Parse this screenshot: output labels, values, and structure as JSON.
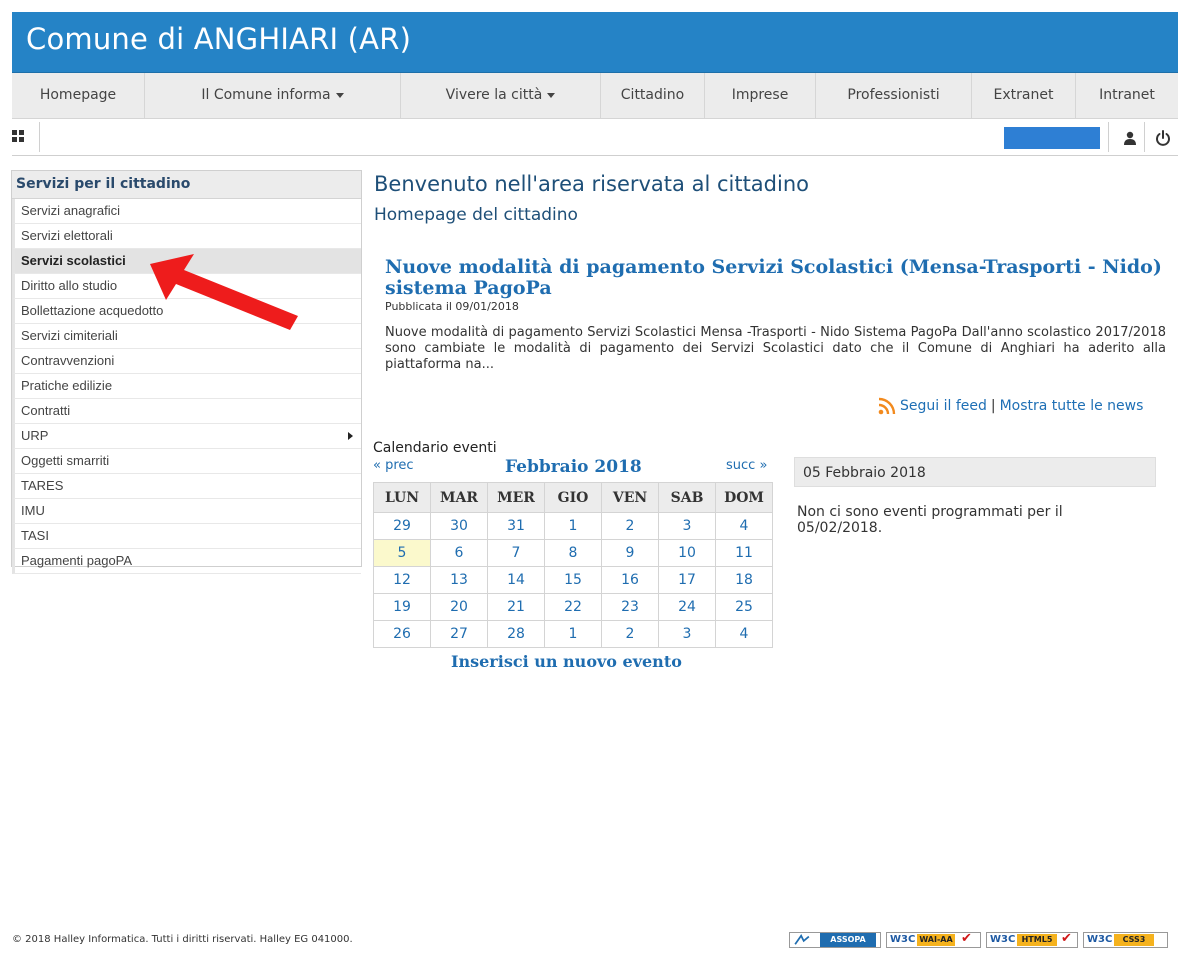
{
  "header": {
    "title": "Comune di ANGHIARI (AR)"
  },
  "nav": {
    "items": [
      {
        "label": "Homepage"
      },
      {
        "label": "Il Comune informa"
      },
      {
        "label": "Vivere la città"
      },
      {
        "label": "Cittadino"
      },
      {
        "label": "Imprese"
      },
      {
        "label": "Professionisti"
      },
      {
        "label": "Extranet"
      },
      {
        "label": "Intranet"
      }
    ]
  },
  "toolbar": {
    "icons": [
      "grid-icon",
      "user-icon",
      "power-icon"
    ],
    "accent": "#2e7fd4"
  },
  "sidebar": {
    "title": "Servizi per il cittadino",
    "items": [
      {
        "label": "Servizi anagrafici"
      },
      {
        "label": "Servizi elettorali"
      },
      {
        "label": "Servizi scolastici"
      },
      {
        "label": "Diritto allo studio"
      },
      {
        "label": "Bollettazione acquedotto"
      },
      {
        "label": "Servizi cimiteriali"
      },
      {
        "label": "Contravvenzioni"
      },
      {
        "label": "Pratiche edilizie"
      },
      {
        "label": "Contratti"
      },
      {
        "label": "URP"
      },
      {
        "label": "Oggetti smarriti"
      },
      {
        "label": "TARES"
      },
      {
        "label": "IMU"
      },
      {
        "label": "TASI"
      },
      {
        "label": "Pagamenti pagoPA"
      }
    ]
  },
  "main": {
    "title": "Benvenuto nell'area riservata al cittadino",
    "subtitle": "Homepage del cittadino",
    "news": {
      "title": "Nuove modalità di pagamento Servizi Scolastici (Mensa-Trasporti - Nido) sistema PagoPa",
      "date": "Pubblicata il 09/01/2018",
      "body": "Nuove modalità di pagamento Servizi Scolastici Mensa -Trasporti - Nido Sistema PagoPa  Dall'anno scolastico 2017/2018 sono cambiate le modalità di pagamento dei Servizi Scolastici dato che il Comune di Anghiari ha aderito alla piattaforma na..."
    },
    "feed": {
      "follow": "Segui il feed",
      "separator": "|",
      "all_news": "Mostra tutte le news"
    }
  },
  "calendar": {
    "label": "Calendario eventi",
    "prev": "« prec",
    "month": "Febbraio 2018",
    "next": "succ »",
    "days": [
      "LUN",
      "MAR",
      "MER",
      "GIO",
      "VEN",
      "SAB",
      "DOM"
    ],
    "weeks": [
      [
        "29",
        "30",
        "31",
        "1",
        "2",
        "3",
        "4"
      ],
      [
        "5",
        "6",
        "7",
        "8",
        "9",
        "10",
        "11"
      ],
      [
        "12",
        "13",
        "14",
        "15",
        "16",
        "17",
        "18"
      ],
      [
        "19",
        "20",
        "21",
        "22",
        "23",
        "24",
        "25"
      ],
      [
        "26",
        "27",
        "28",
        "1",
        "2",
        "3",
        "4"
      ]
    ],
    "add_event": "Inserisci un nuovo evento"
  },
  "events": {
    "date": "05 Febbraio 2018",
    "message": "Non ci sono eventi programmati per il 05/02/2018."
  },
  "footer": {
    "text": "© 2018 Halley Informatica. Tutti i diritti riservati. Halley EG 041000."
  },
  "badges": [
    {
      "label": "ASSOPA"
    },
    {
      "w3c": "W3C",
      "label": "WAI-AA"
    },
    {
      "w3c": "W3C",
      "label": "HTML5"
    },
    {
      "w3c": "W3C",
      "label": "CSS3"
    }
  ]
}
